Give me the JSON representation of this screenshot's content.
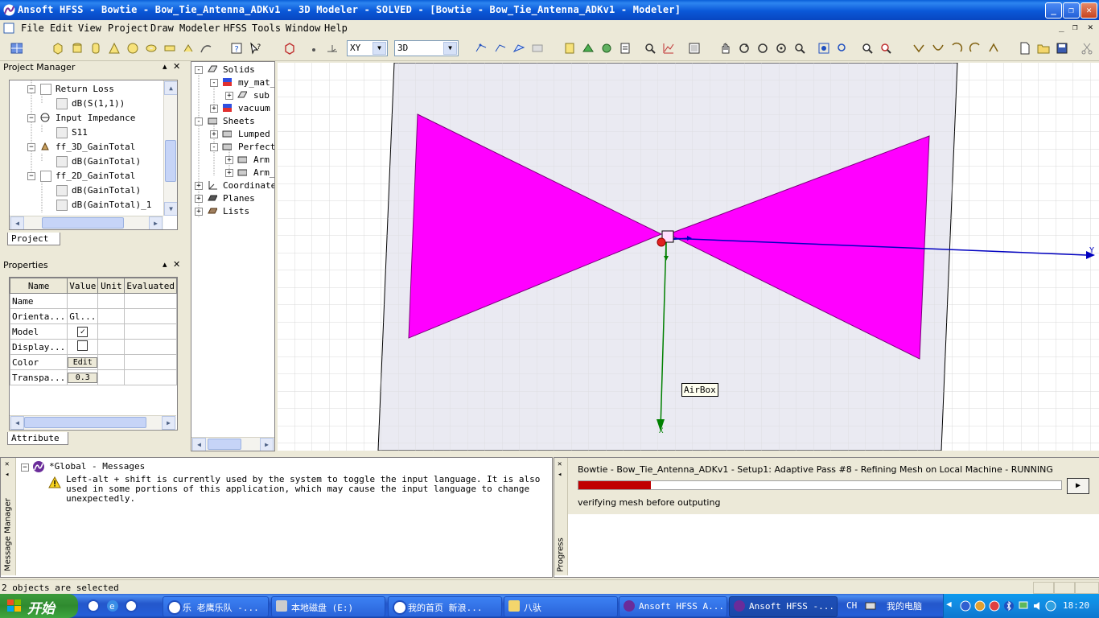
{
  "window": {
    "title": "Ansoft HFSS - Bowtie - Bow_Tie_Antenna_ADKv1 - 3D Modeler - SOLVED - [Bowtie - Bow_Tie_Antenna_ADKv1 - Modeler]"
  },
  "menu": [
    "File",
    "Edit",
    "View",
    "Project",
    "Draw",
    "Modeler",
    "HFSS",
    "Tools",
    "Window",
    "Help"
  ],
  "toolbar": {
    "plane_value": "XY",
    "view_value": "3D"
  },
  "project_manager": {
    "header": "Project Manager",
    "items": [
      {
        "label": "Return Loss",
        "type": "report"
      },
      {
        "label": "dB(S(1,1))",
        "type": "trace"
      },
      {
        "label": "Input Impedance",
        "type": "report"
      },
      {
        "label": "S11",
        "type": "trace"
      },
      {
        "label": "ff_3D_GainTotal",
        "type": "report"
      },
      {
        "label": "dB(GainTotal)",
        "type": "trace"
      },
      {
        "label": "ff_2D_GainTotal",
        "type": "report"
      },
      {
        "label": "dB(GainTotal)",
        "type": "trace"
      },
      {
        "label": "dB(GainTotal)_1",
        "type": "trace"
      }
    ],
    "tab": "Project"
  },
  "model_tree": {
    "items": [
      {
        "label": "Solids",
        "sign": "-"
      },
      {
        "label": "my_mat_",
        "sign": "-"
      },
      {
        "label": "sub",
        "sign": "+"
      },
      {
        "label": "vacuum",
        "sign": "+"
      },
      {
        "label": "Sheets",
        "sign": "-"
      },
      {
        "label": "Lumped",
        "sign": "+"
      },
      {
        "label": "Perfect",
        "sign": "-"
      },
      {
        "label": "Arm",
        "sign": "+"
      },
      {
        "label": "Arm_",
        "sign": "+"
      },
      {
        "label": "Coordinate",
        "sign": "+"
      },
      {
        "label": "Planes",
        "sign": "+"
      },
      {
        "label": "Lists",
        "sign": "+"
      }
    ]
  },
  "properties": {
    "header": "Properties",
    "columns": [
      "Name",
      "Value",
      "Unit",
      "Evaluated"
    ],
    "rows": [
      {
        "name": "Name",
        "value": ""
      },
      {
        "name": "Orienta...",
        "value": "Gl..."
      },
      {
        "name": "Model",
        "value": "checked"
      },
      {
        "name": "Display...",
        "value": "unchecked"
      },
      {
        "name": "Color",
        "value": "Edit"
      },
      {
        "name": "Transpa...",
        "value": "0.3"
      }
    ],
    "tab": "Attribute"
  },
  "viewport": {
    "label": "AirBox",
    "axis_y": "Y",
    "axis_x": "X",
    "antenna_color": "#FF00FF",
    "airbox_color": "#E6E6F0"
  },
  "messages": {
    "side_label": "Message Manager",
    "group": "*Global - Messages",
    "warning": "Left-alt + shift is currently used by the system to toggle the input language. It is also used in some portions of this application, which may cause the input language to change unexpectedly."
  },
  "progress": {
    "side_label": "Progress",
    "task": "Bowtie - Bow_Tie_Antenna_ADKv1 - Setup1: Adaptive Pass #8 - Refining Mesh on Local Machine - RUNNING",
    "fraction": 0.15,
    "status": "verifying mesh before outputing"
  },
  "status_bar": {
    "text": "2 objects are selected"
  },
  "taskbar": {
    "start": "开始",
    "tasks": [
      {
        "label": "乐 老鹰乐队 -...",
        "active": false
      },
      {
        "label": "本地磁盘 (E:)",
        "active": false
      },
      {
        "label": "我的首页 新浪...",
        "active": false
      },
      {
        "label": "八驮",
        "active": false
      },
      {
        "label": "Ansoft HFSS A...",
        "active": false
      },
      {
        "label": "Ansoft HFSS -...",
        "active": true
      }
    ],
    "lang": "CH",
    "computer": "我的电脑",
    "time": "18:20"
  }
}
